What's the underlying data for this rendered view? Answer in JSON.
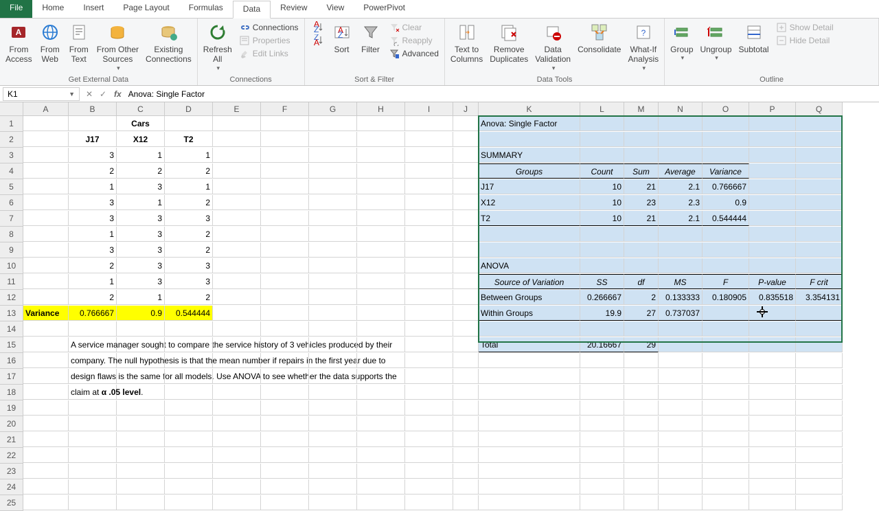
{
  "tabs": {
    "file": "File",
    "home": "Home",
    "insert": "Insert",
    "pageLayout": "Page Layout",
    "formulas": "Formulas",
    "data": "Data",
    "review": "Review",
    "view": "View",
    "powerPivot": "PowerPivot"
  },
  "ribbon": {
    "getExternal": {
      "label": "Get External Data",
      "fromAccess": "From\nAccess",
      "fromWeb": "From\nWeb",
      "fromText": "From\nText",
      "fromOther": "From Other\nSources",
      "existing": "Existing\nConnections"
    },
    "connections": {
      "refresh": "Refresh\nAll",
      "conn": "Connections",
      "props": "Properties",
      "editLinks": "Edit Links",
      "label": "Connections"
    },
    "sortFilter": {
      "sort": "Sort",
      "filter": "Filter",
      "clear": "Clear",
      "reapply": "Reapply",
      "advanced": "Advanced",
      "label": "Sort & Filter"
    },
    "dataTools": {
      "textToCols": "Text to\nColumns",
      "removeDup": "Remove\nDuplicates",
      "validation": "Data\nValidation",
      "consolidate": "Consolidate",
      "whatIf": "What-If\nAnalysis",
      "label": "Data Tools"
    },
    "outline": {
      "group": "Group",
      "ungroup": "Ungroup",
      "subtotal": "Subtotal",
      "showDetail": "Show Detail",
      "hideDetail": "Hide Detail",
      "label": "Outline"
    }
  },
  "formulaBar": {
    "cellRef": "K1",
    "value": "Anova: Single Factor"
  },
  "cols": [
    "A",
    "B",
    "C",
    "D",
    "E",
    "F",
    "G",
    "H",
    "I",
    "J",
    "K",
    "L",
    "M",
    "N",
    "O",
    "P",
    "Q"
  ],
  "sheet": {
    "carsTitle": "Cars",
    "headers": {
      "b": "J17",
      "c": "X12",
      "d": "T2"
    },
    "data": {
      "b": [
        "3",
        "2",
        "1",
        "3",
        "3",
        "1",
        "3",
        "2",
        "1",
        "2"
      ],
      "c": [
        "1",
        "2",
        "3",
        "1",
        "3",
        "3",
        "3",
        "3",
        "3",
        "1"
      ],
      "d": [
        "1",
        "2",
        "1",
        "2",
        "3",
        "2",
        "2",
        "3",
        "3",
        "2"
      ]
    },
    "varianceLabel": "Variance",
    "variance": {
      "b": "0.766667",
      "c": "0.9",
      "d": "0.544444"
    },
    "note1": "A service manager sought to compare the service history of 3 vehicles produced by their",
    "note2": "company. The null hypothesis is that the mean number if repairs in the first year due to",
    "note3": "design flaws is the same for all models. Use ANOVA to see whether the data supports the",
    "note4a": "claim at ",
    "note4b": "α .05 level",
    "note4c": "."
  },
  "anova": {
    "title": "Anova: Single Factor",
    "summary": "SUMMARY",
    "hdr": {
      "groups": "Groups",
      "count": "Count",
      "sum": "Sum",
      "avg": "Average",
      "var": "Variance"
    },
    "rows": [
      {
        "g": "J17",
        "c": "10",
        "s": "21",
        "a": "2.1",
        "v": "0.766667"
      },
      {
        "g": "X12",
        "c": "10",
        "s": "23",
        "a": "2.3",
        "v": "0.9"
      },
      {
        "g": "T2",
        "c": "10",
        "s": "21",
        "a": "2.1",
        "v": "0.544444"
      }
    ],
    "anovaLbl": "ANOVA",
    "ahdr": {
      "src": "Source of Variation",
      "ss": "SS",
      "df": "df",
      "ms": "MS",
      "f": "F",
      "p": "P-value",
      "fc": "F crit"
    },
    "between": {
      "lbl": "Between Groups",
      "ss": "0.266667",
      "df": "2",
      "ms": "0.133333",
      "f": "0.180905",
      "p": "0.835518",
      "fc": "3.354131"
    },
    "within": {
      "lbl": "Within Groups",
      "ss": "19.9",
      "df": "27",
      "ms": "0.737037"
    },
    "total": {
      "lbl": "Total",
      "ss": "20.16667",
      "df": "29"
    }
  },
  "colWidths": {
    "A": 66,
    "B": 70,
    "C": 70,
    "D": 70,
    "E": 70,
    "F": 70,
    "G": 70,
    "H": 70,
    "I": 70,
    "J": 37,
    "K": 148,
    "L": 64,
    "M": 50,
    "N": 64,
    "O": 68,
    "P": 68,
    "Q": 68
  }
}
